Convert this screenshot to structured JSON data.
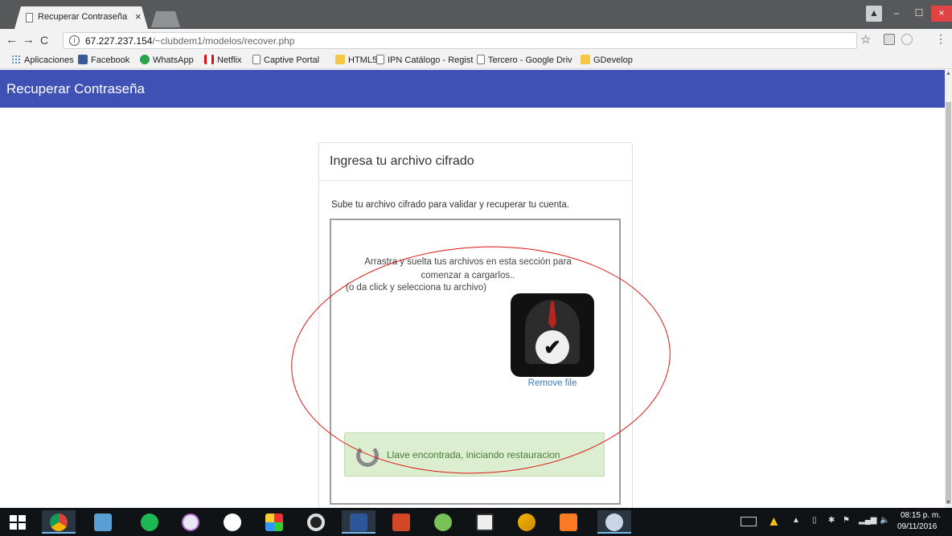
{
  "browser": {
    "tab_title": "Recuperar Contraseña",
    "tab_close": "×",
    "url_host": "67.227.237.154",
    "url_path": "/~clubdem1/modelos/recover.php",
    "info_icon": "ⓘ",
    "nav_back": "←",
    "nav_forward": "→",
    "nav_reload": "C",
    "bookmark_star": "☆",
    "menu": "⋮",
    "window_controls": {
      "user": "▲",
      "minimize": "–",
      "maximize": "☐",
      "close": "×"
    },
    "bookmarks": [
      {
        "label": "Aplicaciones",
        "icon": "apps-grid-icon"
      },
      {
        "label": "Facebook",
        "icon": "facebook-icon"
      },
      {
        "label": "WhatsApp",
        "icon": "whatsapp-icon"
      },
      {
        "label": "Netflix",
        "icon": "netflix-icon"
      },
      {
        "label": "Captive Portal",
        "icon": "page-icon"
      },
      {
        "label": "HTML5",
        "icon": "folder-icon"
      },
      {
        "label": "IPN Catálogo - Regist",
        "icon": "page-icon"
      },
      {
        "label": "Tercero - Google Driv",
        "icon": "page-icon"
      },
      {
        "label": "GDevelop",
        "icon": "folder-icon"
      }
    ]
  },
  "appbar": {
    "title": "Recuperar Contraseña",
    "color": "#3f51b5"
  },
  "card": {
    "title": "Ingresa tu archivo cifrado",
    "description": "Sube tu archivo cifrado para validar y recuperar tu cuenta.",
    "dropzone": {
      "message": "Arrastra y suelta tus archivos en esta sección para comenzar a cargarlos..",
      "message2": "(o da click y selecciona tu archivo)",
      "check_mark": "✔",
      "remove_label": "Remove file"
    },
    "status": {
      "text": "Llave encontrada, iniciando restauracion",
      "color": "#dbeed0"
    }
  },
  "taskbar": {
    "apps": [
      "start-icon",
      "chrome-icon",
      "file-explorer-icon",
      "spotify-icon",
      "itunes-icon",
      "hp-icon",
      "paint-icon",
      "camera-icon",
      "word-icon",
      "powerpoint-icon",
      "android-studio-icon",
      "inkscape-icon",
      "pencil-icon",
      "xampp-icon",
      "snipping-tool-icon"
    ],
    "tray": {
      "arrow": "▲",
      "battery": "▯",
      "bluetooth": "✱",
      "flag": "⚑",
      "signal": "▂▄▆",
      "volume": "🔈"
    },
    "clock_time": "08:15 p. m.",
    "clock_date": "09/11/2016"
  }
}
